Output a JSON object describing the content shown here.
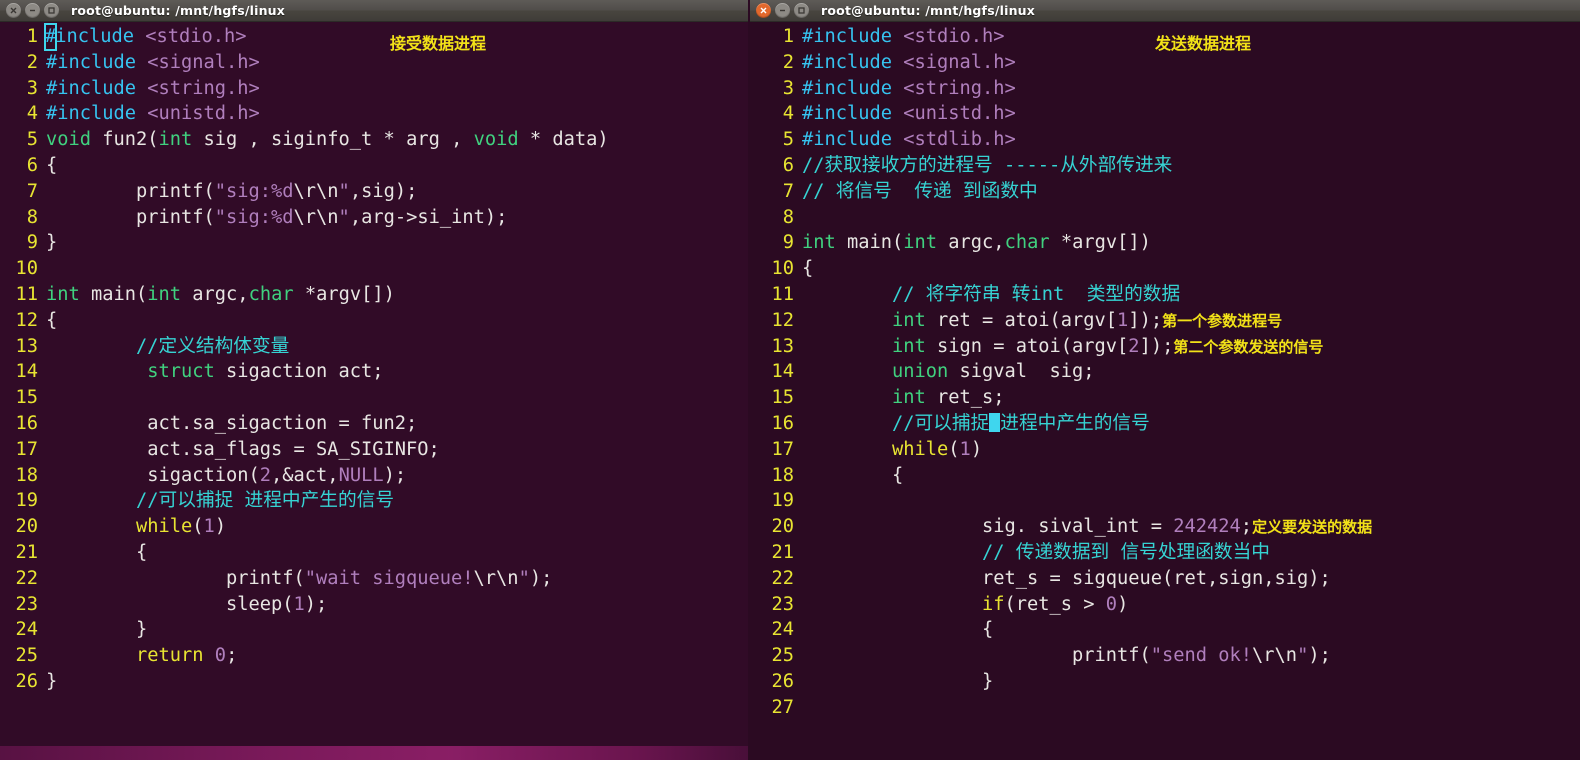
{
  "windows": [
    {
      "id": "left",
      "title": "root@ubuntu: /mnt/hgfs/linux",
      "active": false,
      "buttons": {
        "close": "close-icon",
        "minimize": "minimize-icon",
        "maximize": "maximize-icon"
      },
      "annotation": "接受数据进程",
      "code_lines": [
        {
          "n": "1",
          "tokens": [
            {
              "t": "pre",
              "v": "#include",
              "cursor_first_char": true
            },
            {
              "t": "plain",
              "v": " "
            },
            {
              "t": "hdr",
              "v": "<stdio.h>"
            }
          ]
        },
        {
          "n": "2",
          "tokens": [
            {
              "t": "pre",
              "v": "#include"
            },
            {
              "t": "plain",
              "v": " "
            },
            {
              "t": "hdr",
              "v": "<signal.h>"
            }
          ]
        },
        {
          "n": "3",
          "tokens": [
            {
              "t": "pre",
              "v": "#include"
            },
            {
              "t": "plain",
              "v": " "
            },
            {
              "t": "hdr",
              "v": "<string.h>"
            }
          ]
        },
        {
          "n": "4",
          "tokens": [
            {
              "t": "pre",
              "v": "#include"
            },
            {
              "t": "plain",
              "v": " "
            },
            {
              "t": "hdr",
              "v": "<unistd.h>"
            }
          ]
        },
        {
          "n": "5",
          "tokens": [
            {
              "t": "kw",
              "v": "void"
            },
            {
              "t": "plain",
              "v": " fun2("
            },
            {
              "t": "kw",
              "v": "int"
            },
            {
              "t": "plain",
              "v": " sig , siginfo_t * arg , "
            },
            {
              "t": "kw",
              "v": "void"
            },
            {
              "t": "plain",
              "v": " * data)"
            }
          ]
        },
        {
          "n": "6",
          "tokens": [
            {
              "t": "plain",
              "v": "{"
            }
          ]
        },
        {
          "n": "7",
          "tokens": [
            {
              "t": "plain",
              "v": "        printf("
            },
            {
              "t": "str",
              "v": "\"sig:%d"
            },
            {
              "t": "esc",
              "v": "\\r\\n"
            },
            {
              "t": "str",
              "v": "\""
            },
            {
              "t": "plain",
              "v": ",sig);"
            }
          ]
        },
        {
          "n": "8",
          "tokens": [
            {
              "t": "plain",
              "v": "        printf("
            },
            {
              "t": "str",
              "v": "\"sig:%d"
            },
            {
              "t": "esc",
              "v": "\\r\\n"
            },
            {
              "t": "str",
              "v": "\""
            },
            {
              "t": "plain",
              "v": ",arg->si_int);"
            }
          ]
        },
        {
          "n": "9",
          "tokens": [
            {
              "t": "plain",
              "v": "}"
            }
          ]
        },
        {
          "n": "10",
          "tokens": []
        },
        {
          "n": "11",
          "tokens": [
            {
              "t": "kw",
              "v": "int"
            },
            {
              "t": "plain",
              "v": " main("
            },
            {
              "t": "kw",
              "v": "int"
            },
            {
              "t": "plain",
              "v": " argc,"
            },
            {
              "t": "kw",
              "v": "char"
            },
            {
              "t": "plain",
              "v": " *argv[])"
            }
          ]
        },
        {
          "n": "12",
          "tokens": [
            {
              "t": "plain",
              "v": "{"
            }
          ]
        },
        {
          "n": "13",
          "tokens": [
            {
              "t": "plain",
              "v": "        "
            },
            {
              "t": "cmt",
              "v": "//定义结构体变量"
            }
          ]
        },
        {
          "n": "14",
          "tokens": [
            {
              "t": "plain",
              "v": "         "
            },
            {
              "t": "kw",
              "v": "struct"
            },
            {
              "t": "plain",
              "v": " sigaction act;"
            }
          ]
        },
        {
          "n": "15",
          "tokens": []
        },
        {
          "n": "16",
          "tokens": [
            {
              "t": "plain",
              "v": "         act.sa_sigaction = fun2;"
            }
          ]
        },
        {
          "n": "17",
          "tokens": [
            {
              "t": "plain",
              "v": "         act.sa_flags = SA_SIGINFO;"
            }
          ]
        },
        {
          "n": "18",
          "tokens": [
            {
              "t": "plain",
              "v": "         sigaction("
            },
            {
              "t": "num",
              "v": "2"
            },
            {
              "t": "plain",
              "v": ",&act,"
            },
            {
              "t": "const",
              "v": "NULL"
            },
            {
              "t": "plain",
              "v": ");"
            }
          ]
        },
        {
          "n": "19",
          "tokens": [
            {
              "t": "plain",
              "v": "        "
            },
            {
              "t": "cmt",
              "v": "//可以捕捉 进程中产生的信号"
            }
          ]
        },
        {
          "n": "20",
          "tokens": [
            {
              "t": "plain",
              "v": "        "
            },
            {
              "t": "ctl",
              "v": "while"
            },
            {
              "t": "plain",
              "v": "("
            },
            {
              "t": "num",
              "v": "1"
            },
            {
              "t": "plain",
              "v": ")"
            }
          ]
        },
        {
          "n": "21",
          "tokens": [
            {
              "t": "plain",
              "v": "        {"
            }
          ]
        },
        {
          "n": "22",
          "tokens": [
            {
              "t": "plain",
              "v": "                printf("
            },
            {
              "t": "str",
              "v": "\"wait sigqueue!"
            },
            {
              "t": "esc",
              "v": "\\r\\n"
            },
            {
              "t": "str",
              "v": "\""
            },
            {
              "t": "plain",
              "v": ");"
            }
          ]
        },
        {
          "n": "23",
          "tokens": [
            {
              "t": "plain",
              "v": "                sleep("
            },
            {
              "t": "num",
              "v": "1"
            },
            {
              "t": "plain",
              "v": ");"
            }
          ]
        },
        {
          "n": "24",
          "tokens": [
            {
              "t": "plain",
              "v": "        }"
            }
          ]
        },
        {
          "n": "25",
          "tokens": [
            {
              "t": "plain",
              "v": "        "
            },
            {
              "t": "ctl",
              "v": "return"
            },
            {
              "t": "plain",
              "v": " "
            },
            {
              "t": "num",
              "v": "0"
            },
            {
              "t": "plain",
              "v": ";"
            }
          ]
        },
        {
          "n": "26",
          "tokens": [
            {
              "t": "plain",
              "v": "}"
            }
          ]
        }
      ]
    },
    {
      "id": "right",
      "title": "root@ubuntu: /mnt/hgfs/linux",
      "active": true,
      "buttons": {
        "close": "close-icon",
        "minimize": "minimize-icon",
        "maximize": "maximize-icon"
      },
      "annotation": "发送数据进程",
      "code_lines": [
        {
          "n": "1",
          "tokens": [
            {
              "t": "pre",
              "v": "#include"
            },
            {
              "t": "plain",
              "v": " "
            },
            {
              "t": "hdr",
              "v": "<stdio.h>"
            }
          ]
        },
        {
          "n": "2",
          "tokens": [
            {
              "t": "pre",
              "v": "#include"
            },
            {
              "t": "plain",
              "v": " "
            },
            {
              "t": "hdr",
              "v": "<signal.h>"
            }
          ]
        },
        {
          "n": "3",
          "tokens": [
            {
              "t": "pre",
              "v": "#include"
            },
            {
              "t": "plain",
              "v": " "
            },
            {
              "t": "hdr",
              "v": "<string.h>"
            }
          ]
        },
        {
          "n": "4",
          "tokens": [
            {
              "t": "pre",
              "v": "#include"
            },
            {
              "t": "plain",
              "v": " "
            },
            {
              "t": "hdr",
              "v": "<unistd.h>"
            }
          ]
        },
        {
          "n": "5",
          "tokens": [
            {
              "t": "pre",
              "v": "#include"
            },
            {
              "t": "plain",
              "v": " "
            },
            {
              "t": "hdr",
              "v": "<stdlib.h>"
            }
          ]
        },
        {
          "n": "6",
          "tokens": [
            {
              "t": "cmt",
              "v": "//获取接收方的进程号 -----从外部传进来"
            }
          ]
        },
        {
          "n": "7",
          "tokens": [
            {
              "t": "cmt",
              "v": "// 将信号  传递 到函数中"
            }
          ]
        },
        {
          "n": "8",
          "tokens": []
        },
        {
          "n": "9",
          "tokens": [
            {
              "t": "kw",
              "v": "int"
            },
            {
              "t": "plain",
              "v": " main("
            },
            {
              "t": "kw",
              "v": "int"
            },
            {
              "t": "plain",
              "v": " argc,"
            },
            {
              "t": "kw",
              "v": "char"
            },
            {
              "t": "plain",
              "v": " *argv[])"
            }
          ]
        },
        {
          "n": "10",
          "tokens": [
            {
              "t": "plain",
              "v": "{"
            }
          ]
        },
        {
          "n": "11",
          "tokens": [
            {
              "t": "plain",
              "v": "        "
            },
            {
              "t": "cmt",
              "v": "// 将字符串 转int  类型的数据"
            }
          ]
        },
        {
          "n": "12",
          "tokens": [
            {
              "t": "plain",
              "v": "        "
            },
            {
              "t": "kw",
              "v": "int"
            },
            {
              "t": "plain",
              "v": " ret = atoi(argv["
            },
            {
              "t": "num",
              "v": "1"
            },
            {
              "t": "plain",
              "v": "]);"
            },
            {
              "t": "ann",
              "v": "第一个参数进程号"
            }
          ]
        },
        {
          "n": "13",
          "tokens": [
            {
              "t": "plain",
              "v": "        "
            },
            {
              "t": "kw",
              "v": "int"
            },
            {
              "t": "plain",
              "v": " sign = atoi(argv["
            },
            {
              "t": "num",
              "v": "2"
            },
            {
              "t": "plain",
              "v": "]);"
            },
            {
              "t": "ann",
              "v": "第二个参数发送的信号"
            }
          ]
        },
        {
          "n": "14",
          "tokens": [
            {
              "t": "plain",
              "v": "        "
            },
            {
              "t": "kw",
              "v": "union"
            },
            {
              "t": "plain",
              "v": " sigval  sig;"
            }
          ]
        },
        {
          "n": "15",
          "tokens": [
            {
              "t": "plain",
              "v": "        "
            },
            {
              "t": "kw",
              "v": "int"
            },
            {
              "t": "plain",
              "v": " ret_s;"
            }
          ]
        },
        {
          "n": "16",
          "tokens": [
            {
              "t": "plain",
              "v": "        "
            },
            {
              "t": "cmt",
              "v": "//可以捕捉"
            },
            {
              "t": "cursorblock",
              "v": ""
            },
            {
              "t": "cmt",
              "v": "进程中产生的信号"
            }
          ]
        },
        {
          "n": "17",
          "tokens": [
            {
              "t": "plain",
              "v": "        "
            },
            {
              "t": "ctl",
              "v": "while"
            },
            {
              "t": "plain",
              "v": "("
            },
            {
              "t": "num",
              "v": "1"
            },
            {
              "t": "plain",
              "v": ")"
            }
          ]
        },
        {
          "n": "18",
          "tokens": [
            {
              "t": "plain",
              "v": "        {"
            }
          ]
        },
        {
          "n": "19",
          "tokens": []
        },
        {
          "n": "20",
          "tokens": [
            {
              "t": "plain",
              "v": "                sig. sival_int = "
            },
            {
              "t": "num",
              "v": "242424"
            },
            {
              "t": "plain",
              "v": ";"
            },
            {
              "t": "ann",
              "v": "定义要发送的数据"
            }
          ]
        },
        {
          "n": "21",
          "tokens": [
            {
              "t": "plain",
              "v": "                "
            },
            {
              "t": "cmt",
              "v": "// 传递数据到 信号处理函数当中"
            }
          ]
        },
        {
          "n": "22",
          "tokens": [
            {
              "t": "plain",
              "v": "                ret_s = sigqueue(ret,sign,sig);"
            }
          ]
        },
        {
          "n": "23",
          "tokens": [
            {
              "t": "plain",
              "v": "                "
            },
            {
              "t": "ctl",
              "v": "if"
            },
            {
              "t": "plain",
              "v": "(ret_s > "
            },
            {
              "t": "num",
              "v": "0"
            },
            {
              "t": "plain",
              "v": ")"
            }
          ]
        },
        {
          "n": "24",
          "tokens": [
            {
              "t": "plain",
              "v": "                {"
            }
          ]
        },
        {
          "n": "25",
          "tokens": [
            {
              "t": "plain",
              "v": "                        printf("
            },
            {
              "t": "str",
              "v": "\"send ok!"
            },
            {
              "t": "esc",
              "v": "\\r\\n"
            },
            {
              "t": "str",
              "v": "\""
            },
            {
              "t": "plain",
              "v": ");"
            }
          ]
        },
        {
          "n": "26",
          "tokens": [
            {
              "t": "plain",
              "v": "                }"
            }
          ]
        },
        {
          "n": "27",
          "tokens": []
        }
      ]
    }
  ],
  "colors": {
    "terminal_bg_left": "#310b27",
    "terminal_bg_right": "#2b0a22",
    "titlebar_bg": "#504d4a",
    "line_number": "#e8e432",
    "preprocessor": "#36c3f0",
    "header_path": "#b07fbd",
    "keyword": "#40d17f",
    "control": "#e8e432",
    "string": "#b07fbd",
    "number": "#b07fbd",
    "comment": "#36d3d3",
    "plain_text": "#e8e6e3",
    "annotation": "#f2e218",
    "cursor": "#3fd6ee",
    "close_button_active": "#e2682c",
    "bottom_bar": "#8e1f68"
  }
}
